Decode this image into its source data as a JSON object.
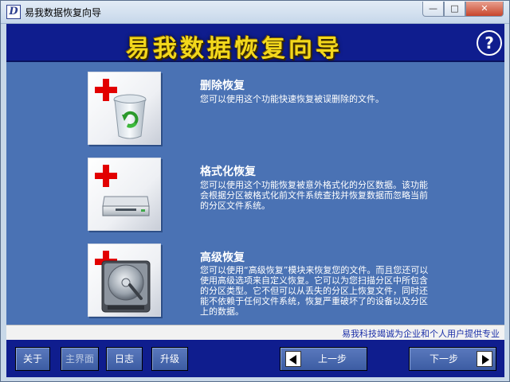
{
  "window": {
    "title": "易我数据恢复向导",
    "icon_letter": "D",
    "controls": {
      "minimize": "—",
      "maximize": "□",
      "close": "✕"
    }
  },
  "banner": {
    "title": "易我数据恢复向导",
    "help_label": "?",
    "color": "#0f1d8e",
    "title_color": "#f3d81c"
  },
  "options": [
    {
      "title": "删除恢复",
      "description": "您可以使用这个功能快速恢复被误删除的文件。",
      "icon": "recycle-bin-icon"
    },
    {
      "title": "格式化恢复",
      "description": "您可以使用这个功能恢复被意外格式化的分区数据。该功能会根据分区被格式化前文件系统查找并恢复数据而忽略当前的分区文件系统。",
      "icon": "drive-icon"
    },
    {
      "title": "高级恢复",
      "description": "您可以使用“高级恢复”模块来恢复您的文件。而且您还可以使用高级选项来自定义恢复。它可以为您扫描分区中所包含的分区类型。它不但可以从丢失的分区上恢复文件，同时还能不依赖于任何文件系统，恢复严重破坏了的设备以及分区上的数据。",
      "icon": "hard-disk-icon"
    }
  ],
  "slogan": "易我科技竭诚为企业和个人用户提供专业",
  "footer": {
    "about": "关于",
    "home": "主界面",
    "log": "日志",
    "upgrade": "升级",
    "prev": "上一步",
    "next": "下一步"
  }
}
